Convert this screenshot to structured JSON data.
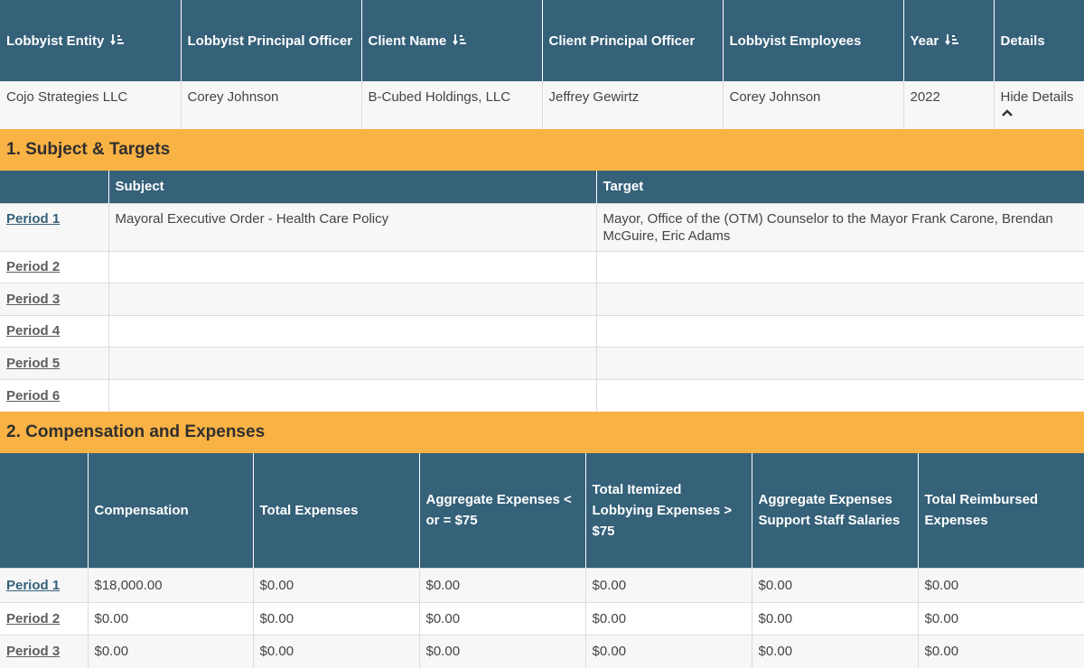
{
  "summary": {
    "headers": {
      "entity": "Lobbyist Entity",
      "principal_officer": "Lobbyist Principal Officer",
      "client_name": "Client Name",
      "client_principal_officer": "Client Principal Officer",
      "employees": "Lobbyist Employees",
      "year": "Year",
      "details": "Details"
    },
    "row": {
      "entity": "Cojo Strategies LLC",
      "principal_officer": "Corey Johnson",
      "client_name": "B-Cubed Holdings, LLC",
      "client_principal_officer": "Jeffrey Gewirtz",
      "employees": "Corey Johnson",
      "year": "2022",
      "details_toggle": "Hide Details"
    },
    "sort_icon": "sort-descending-icon",
    "toggle_icon": "chevron-up-icon"
  },
  "sections": {
    "subject_targets": "1. Subject & Targets",
    "compensation": "2. Compensation and Expenses"
  },
  "subject_table": {
    "headers": {
      "period": "",
      "subject": "Subject",
      "target": "Target"
    },
    "rows": [
      {
        "period": "Period 1",
        "subject": "Mayoral Executive Order - Health Care Policy",
        "target": "Mayor, Office of the (OTM) Counselor to the Mayor Frank Carone, Brendan McGuire, Eric Adams"
      },
      {
        "period": "Period 2",
        "subject": "",
        "target": ""
      },
      {
        "period": "Period 3",
        "subject": "",
        "target": ""
      },
      {
        "period": "Period 4",
        "subject": "",
        "target": ""
      },
      {
        "period": "Period 5",
        "subject": "",
        "target": ""
      },
      {
        "period": "Period 6",
        "subject": "",
        "target": ""
      }
    ]
  },
  "comp_table": {
    "headers": {
      "period": "",
      "compensation": "Compensation",
      "total_expenses": "Total Expenses",
      "aggregate_75": "Aggregate Expenses < or = $75",
      "itemized": "Total Itemized Lobbying Expenses > $75",
      "support_staff": "Aggregate Expenses Support Staff Salaries",
      "reimbursed": "Total Reimbursed Expenses"
    },
    "rows": [
      {
        "period": "Period 1",
        "compensation": "$18,000.00",
        "total_expenses": "$0.00",
        "aggregate_75": "$0.00",
        "itemized": "$0.00",
        "support_staff": "$0.00",
        "reimbursed": "$0.00"
      },
      {
        "period": "Period 2",
        "compensation": "$0.00",
        "total_expenses": "$0.00",
        "aggregate_75": "$0.00",
        "itemized": "$0.00",
        "support_staff": "$0.00",
        "reimbursed": "$0.00"
      },
      {
        "period": "Period 3",
        "compensation": "$0.00",
        "total_expenses": "$0.00",
        "aggregate_75": "$0.00",
        "itemized": "$0.00",
        "support_staff": "$0.00",
        "reimbursed": "$0.00"
      }
    ]
  },
  "colors": {
    "header_bg": "#356179",
    "section_bg": "#f9b244",
    "active_link": "#356179",
    "inactive_link": "#5e5e5e",
    "row_alt": "#f7f7f7"
  }
}
